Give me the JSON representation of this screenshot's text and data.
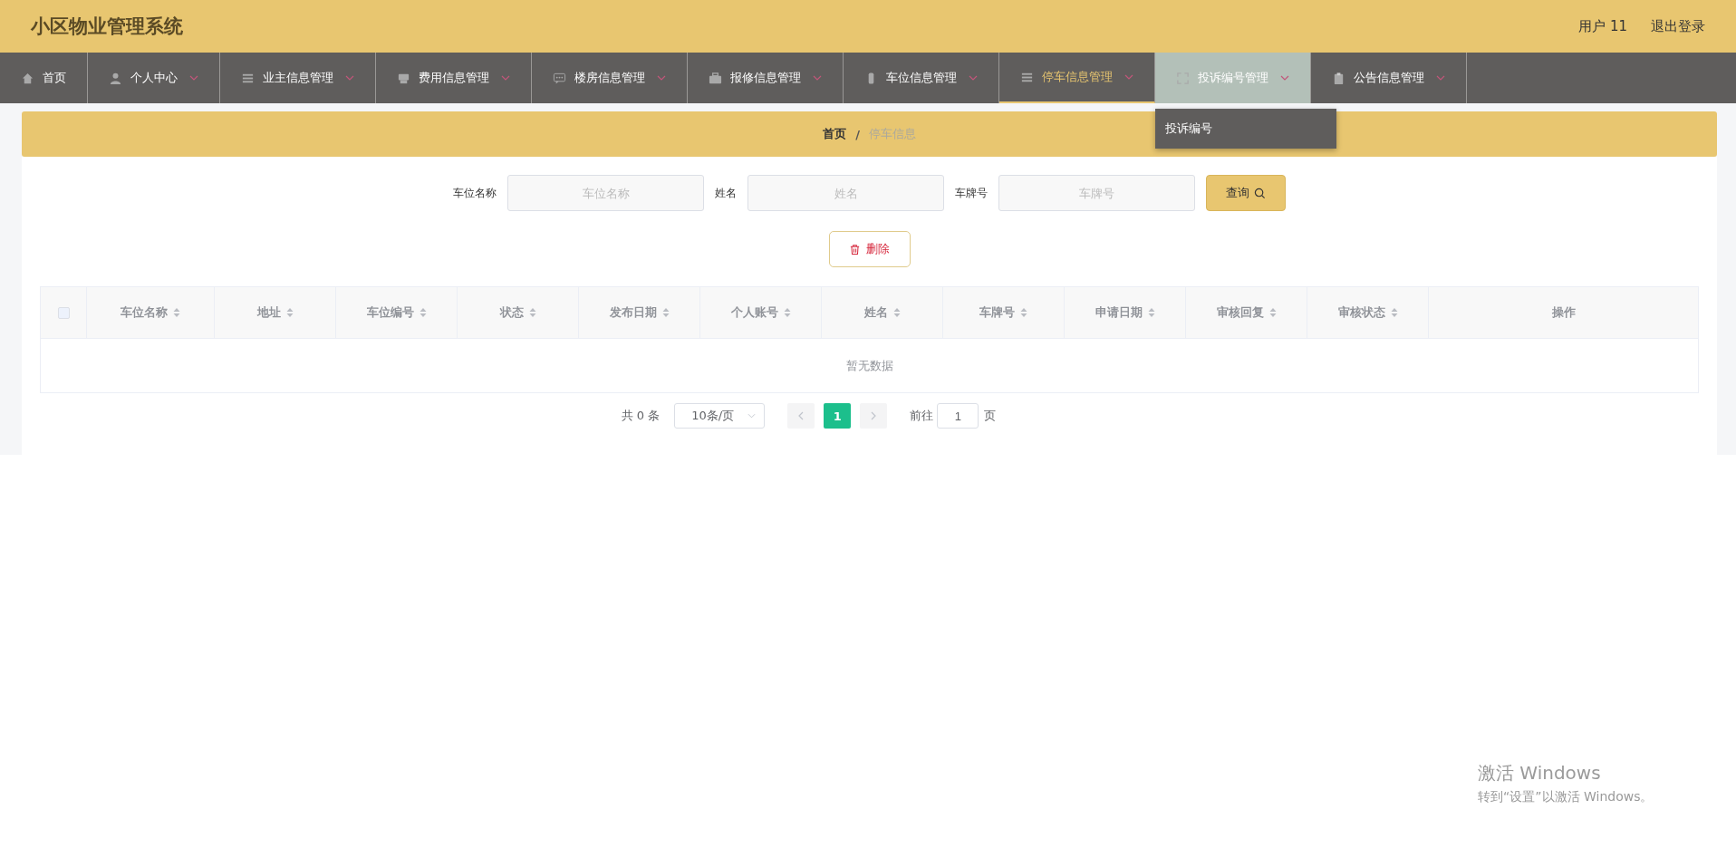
{
  "header": {
    "title": "小区物业管理系统",
    "user": "用户 11",
    "logout": "退出登录"
  },
  "nav": [
    {
      "label": "首页",
      "dropdown": false,
      "selected": false,
      "expanded": false
    },
    {
      "label": "个人中心",
      "dropdown": true,
      "selected": false,
      "expanded": false
    },
    {
      "label": "业主信息管理",
      "dropdown": true,
      "selected": false,
      "expanded": false
    },
    {
      "label": "费用信息管理",
      "dropdown": true,
      "selected": false,
      "expanded": false
    },
    {
      "label": "楼房信息管理",
      "dropdown": true,
      "selected": false,
      "expanded": false
    },
    {
      "label": "报修信息管理",
      "dropdown": true,
      "selected": false,
      "expanded": false
    },
    {
      "label": "车位信息管理",
      "dropdown": true,
      "selected": false,
      "expanded": false
    },
    {
      "label": "停车信息管理",
      "dropdown": true,
      "selected": true,
      "expanded": false
    },
    {
      "label": "投诉编号管理",
      "dropdown": true,
      "selected": false,
      "expanded": true,
      "children": [
        {
          "label": "投诉编号"
        }
      ]
    },
    {
      "label": "公告信息管理",
      "dropdown": true,
      "selected": false,
      "expanded": false
    }
  ],
  "breadcrumb": [
    {
      "label": "首页",
      "current": false
    },
    {
      "label": "停车信息",
      "current": true
    }
  ],
  "breadcrumb_separator": "/",
  "search": {
    "fields": [
      {
        "label": "车位名称",
        "placeholder": "车位名称"
      },
      {
        "label": "姓名",
        "placeholder": "姓名"
      },
      {
        "label": "车牌号",
        "placeholder": "车牌号"
      }
    ],
    "button": "查询"
  },
  "delete_button": "删除",
  "table": {
    "select_all_checked": false,
    "columns": [
      {
        "label": "车位名称",
        "sortable": true
      },
      {
        "label": "地址",
        "sortable": true
      },
      {
        "label": "车位编号",
        "sortable": true
      },
      {
        "label": "状态",
        "sortable": true
      },
      {
        "label": "发布日期",
        "sortable": true
      },
      {
        "label": "个人账号",
        "sortable": true
      },
      {
        "label": "姓名",
        "sortable": true
      },
      {
        "label": "车牌号",
        "sortable": true
      },
      {
        "label": "申请日期",
        "sortable": true
      },
      {
        "label": "审核回复",
        "sortable": true
      },
      {
        "label": "审核状态",
        "sortable": true
      },
      {
        "label": "操作",
        "sortable": false
      }
    ],
    "empty_text": "暂无数据"
  },
  "pagination": {
    "total": "共 0 条",
    "page_size": "10条/页",
    "pages": [
      {
        "label": "1",
        "selected": true
      }
    ],
    "goto_label": "前往",
    "goto_value": "1",
    "goto_suffix": "页"
  },
  "windows_notice": {
    "title": "激活 Windows",
    "text": "转到“设置”以激活 Windows。"
  }
}
